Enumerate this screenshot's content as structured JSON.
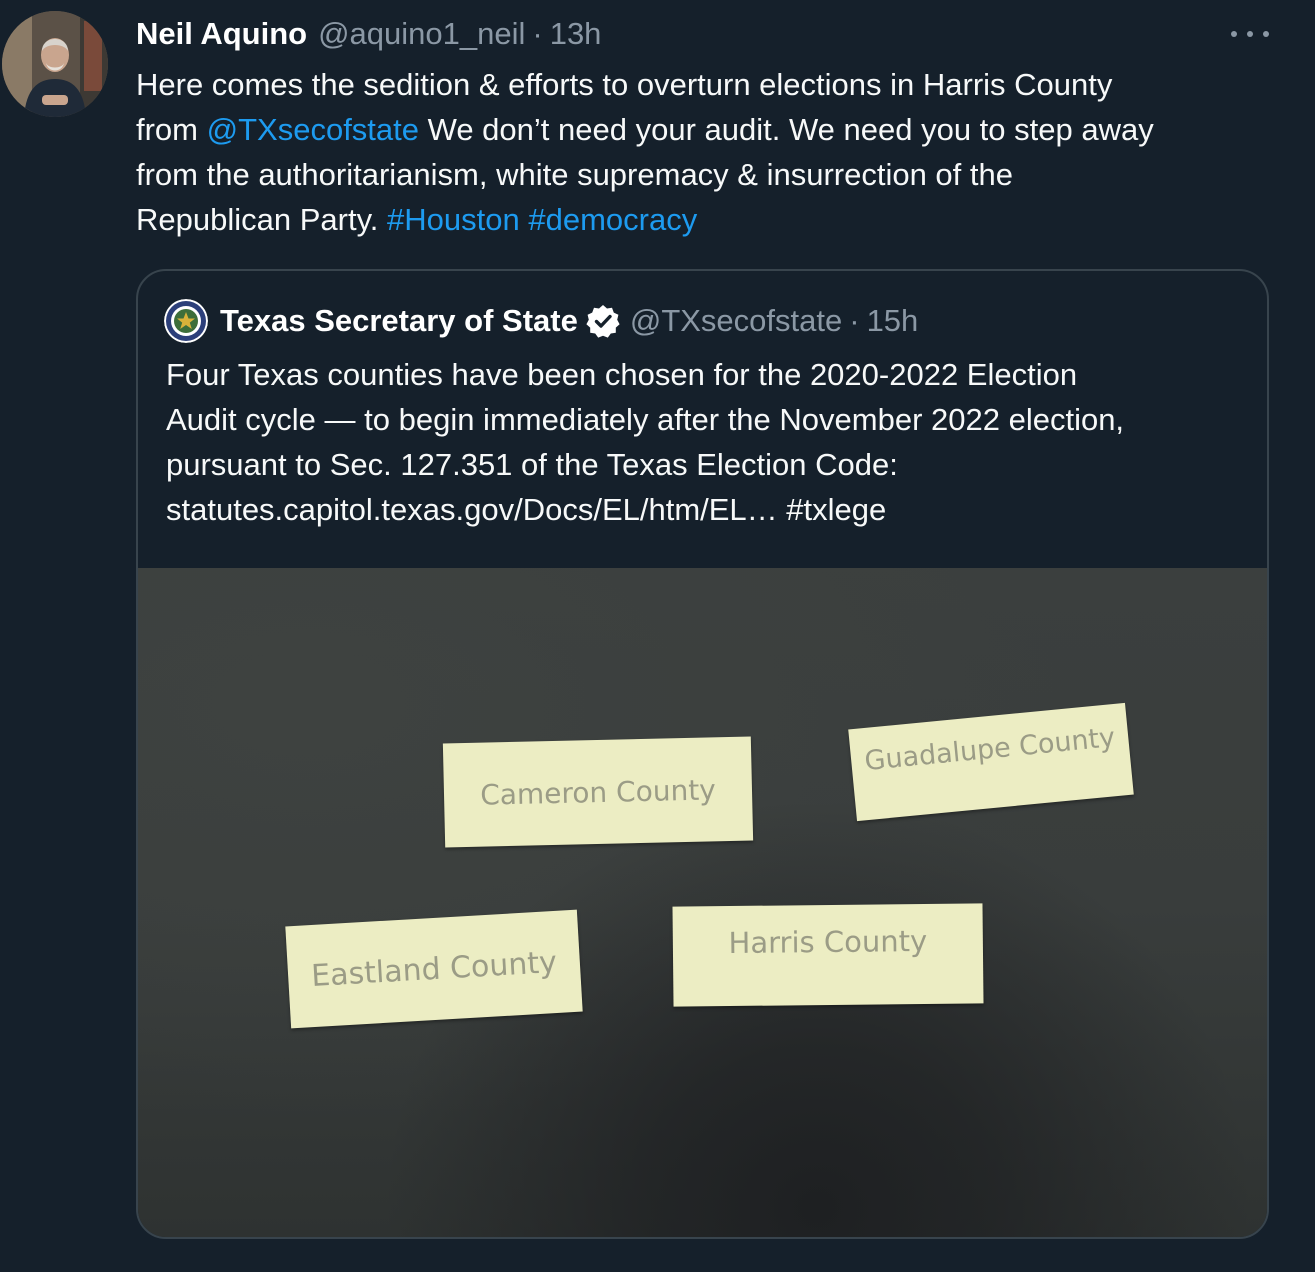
{
  "tweet": {
    "display_name": "Neil Aquino",
    "handle": "@aquino1_neil",
    "separator": "·",
    "time": "13h",
    "text_lines": [
      [
        {
          "t": "Here comes the sedition & efforts to overturn elections in Harris County"
        }
      ],
      [
        {
          "t": "from "
        },
        {
          "t": "@TXsecofstate",
          "link": true
        },
        {
          "t": " We don’t need your audit. We need you to step away"
        }
      ],
      [
        {
          "t": "from the authoritarianism, white supremacy & insurrection of the"
        }
      ],
      [
        {
          "t": "Republican Party. "
        },
        {
          "t": "#Houston",
          "link": true
        },
        {
          "t": " "
        },
        {
          "t": "#democracy",
          "link": true
        }
      ]
    ]
  },
  "quoted": {
    "display_name": "Texas Secretary of State",
    "handle": "@TXsecofstate",
    "separator": "·",
    "time": "15h",
    "text_lines": [
      "Four Texas counties have been chosen for the 2020-2022 Election",
      "Audit cycle — to begin immediately after the November 2022 election,",
      "pursuant to Sec. 127.351 of the Texas Election Code:",
      "statutes.capitol.texas.gov/Docs/EL/htm/EL… #txlege"
    ],
    "image_cards": [
      "Cameron County",
      "Guadalupe County",
      "Eastland County",
      "Harris County"
    ]
  },
  "colors": {
    "background": "#15202b",
    "link": "#1d9bf0",
    "muted": "#8b98a5",
    "border": "#38444d"
  },
  "icons": {
    "more": "more-horizontal-icon",
    "verified": "verified-badge-icon"
  }
}
